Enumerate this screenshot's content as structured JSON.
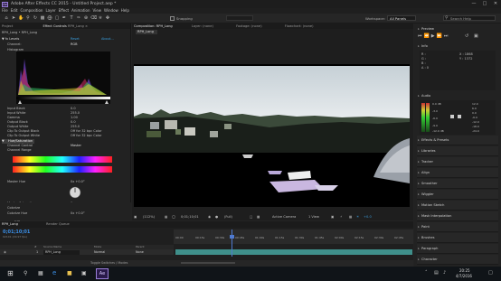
{
  "window": {
    "title": "Adobe After Effects CC 2015 - Untitled Project.aep *",
    "logo": "Ae"
  },
  "menu": [
    "File",
    "Edit",
    "Composition",
    "Layer",
    "Effect",
    "Animation",
    "View",
    "Window",
    "Help"
  ],
  "toolbar": {
    "snapping_label": "Snapping",
    "workspace_label": "Workspace:",
    "workspace_value": "All Panels",
    "search_placeholder": "Search Help"
  },
  "left_panel": {
    "tabs": [
      "Project",
      "Effect Controls",
      "RPH_Long",
      "×"
    ],
    "breadcrumb": "RPH_Long • RPH_Long",
    "effect_name": "Levels",
    "reset_label": "Reset",
    "about_label": "About...",
    "channel_label": "Channel:",
    "channel_value": "RGB",
    "histogram_label": "Histogram",
    "params": [
      {
        "name": "Input Black",
        "value": "0.0"
      },
      {
        "name": "Input White",
        "value": "255.0"
      },
      {
        "name": "Gamma",
        "value": "1.00"
      },
      {
        "name": "Output Black",
        "value": "0.0"
      },
      {
        "name": "Output White",
        "value": "255.0"
      },
      {
        "name": "Clip To Output Black",
        "value": "Off for 32 bpc Color"
      },
      {
        "name": "Clip To Output White",
        "value": "Off for 32 bpc Color"
      }
    ],
    "effect2_name": "Hue/Saturation",
    "channel_control_label": "Channel Control",
    "channel_control_value": "Master",
    "channel_range_label": "Channel Range",
    "master_hue_label": "Master Hue",
    "master_hue_value": "0x +0.0°",
    "master_saturation_label": "Master Saturation",
    "master_saturation_value": "0",
    "master_lightness_label": "Master Lightness",
    "master_lightness_value": "0",
    "range_max": "100",
    "range_min": "-100",
    "colorize_label": "Colorize",
    "colorize_hue_label": "Colorize Hue",
    "colorize_hue_value": "0x +0.0°"
  },
  "comp_panel": {
    "tabs": [
      "Composition: RPH_Long",
      "Layer: (none)",
      "Footage: (none)",
      "Flowchart: (none)"
    ],
    "comp_tab": "RPH_Long",
    "zoom": "(112%)",
    "timecode": "0;01;10;01",
    "resolution": "(Full)",
    "camera": "Active Camera",
    "views": "1 View",
    "exposure": "+0.0"
  },
  "right_panel": {
    "preview_title": "Preview",
    "info_title": "Info",
    "info_lines": [
      "R :",
      "G :",
      "B :",
      "A : 0"
    ],
    "info_coords": [
      "X : 1868",
      "Y : 1372"
    ],
    "audio_title": "Audio",
    "audio_values": [
      "0.0 dB",
      "-3.0",
      "-6.0",
      "-9.0",
      "-12.0 dB"
    ],
    "audio_scale": [
      "12.0",
      "6.0",
      "0.0",
      "-6.0",
      "-12.0",
      "-18.0",
      "-24.0"
    ],
    "sections": [
      "Effects & Presets",
      "Libraries",
      "Tracker",
      "Align",
      "Smoother",
      "Wiggler",
      "Motion Sketch",
      "Mask Interpolation",
      "Paint",
      "Brushes",
      "Paragraph",
      "Character"
    ]
  },
  "timeline": {
    "tabs": [
      "RPH_Long",
      "Render Queue"
    ],
    "timecode": "0;01;10;01",
    "frames": "02101 (29.97 fps)",
    "column_headers": [
      "#",
      "Source Name",
      "Mode",
      "Parent"
    ],
    "layer": {
      "index": "1",
      "name": "RPH_Long",
      "mode": "Normal",
      "parent": "None"
    },
    "ruler": [
      "00:00",
      "00:15s",
      "00:30s",
      "00:45s",
      "01:00s",
      "01:15s",
      "01:30s",
      "01:45s",
      "02:00s",
      "02:15s",
      "02:30s",
      "02:45s"
    ],
    "toggle_label": "Toggle Switches / Modes"
  },
  "taskbar": {
    "time": "20:25",
    "date": "4/7/2016"
  },
  "colors": {
    "accent": "#3a8ee6",
    "timeline_bar": "#3f8f8a",
    "playhead": "#4f7ad0"
  }
}
